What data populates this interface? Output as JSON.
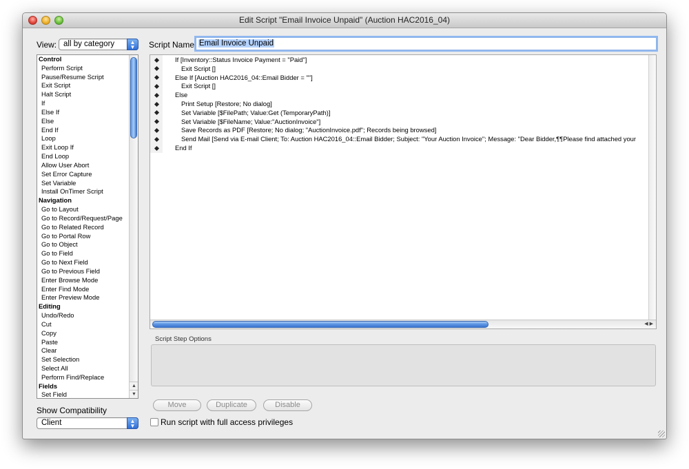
{
  "window": {
    "title": "Edit Script \"Email Invoice Unpaid\" (Auction HAC2016_04)"
  },
  "view": {
    "label": "View:",
    "value": "all by category"
  },
  "script_name": {
    "label": "Script Name:",
    "value": "Email Invoice Unpaid"
  },
  "steps": [
    {
      "label": "Control",
      "category": true
    },
    {
      "label": "Perform Script"
    },
    {
      "label": "Pause/Resume Script"
    },
    {
      "label": "Exit Script"
    },
    {
      "label": "Halt Script"
    },
    {
      "label": "If"
    },
    {
      "label": "Else If"
    },
    {
      "label": "Else"
    },
    {
      "label": "End If"
    },
    {
      "label": "Loop"
    },
    {
      "label": "Exit Loop If"
    },
    {
      "label": "End Loop"
    },
    {
      "label": "Allow User Abort"
    },
    {
      "label": "Set Error Capture"
    },
    {
      "label": "Set Variable"
    },
    {
      "label": "Install OnTimer Script"
    },
    {
      "label": "Navigation",
      "category": true
    },
    {
      "label": "Go to Layout"
    },
    {
      "label": "Go to Record/Request/Page"
    },
    {
      "label": "Go to Related Record"
    },
    {
      "label": "Go to Portal Row"
    },
    {
      "label": "Go to Object"
    },
    {
      "label": "Go to Field"
    },
    {
      "label": "Go to Next Field"
    },
    {
      "label": "Go to Previous Field"
    },
    {
      "label": "Enter Browse Mode"
    },
    {
      "label": "Enter Find Mode"
    },
    {
      "label": "Enter Preview Mode"
    },
    {
      "label": "Editing",
      "category": true
    },
    {
      "label": "Undo/Redo"
    },
    {
      "label": "Cut"
    },
    {
      "label": "Copy"
    },
    {
      "label": "Paste"
    },
    {
      "label": "Clear"
    },
    {
      "label": "Set Selection"
    },
    {
      "label": "Select All"
    },
    {
      "label": "Perform Find/Replace"
    },
    {
      "label": "Fields",
      "category": true
    },
    {
      "label": "Set Field"
    }
  ],
  "script_lines": [
    {
      "text": "If [Inventory::Status Invoice Payment = \"Paid\"]",
      "indent": 0
    },
    {
      "text": "Exit Script []",
      "indent": 1
    },
    {
      "text": "Else If [Auction HAC2016_04::Email Bidder = \"\"]",
      "indent": 0
    },
    {
      "text": "Exit Script []",
      "indent": 1
    },
    {
      "text": "Else",
      "indent": 0
    },
    {
      "text": "Print Setup [Restore; No dialog]",
      "indent": 1
    },
    {
      "text": "Set Variable [$FilePath; Value:Get (TemporaryPath)]",
      "indent": 1
    },
    {
      "text": "Set Variable [$FileName; Value:\"AuctionInvoice\"]",
      "indent": 1
    },
    {
      "text": "Save Records as PDF [Restore; No dialog; \"AuctionInvoice.pdf\"; Records being browsed]",
      "indent": 1
    },
    {
      "text": "Send Mail [Send via E-mail Client; To: Auction HAC2016_04::Email Bidder; Subject: \"Your Auction Invoice\"; Message: \"Dear Bidder,¶¶Please find attached your",
      "indent": 1
    },
    {
      "text": "End If",
      "indent": 0
    }
  ],
  "options": {
    "label": "Script Step Options"
  },
  "buttons": {
    "move": "Move",
    "duplicate": "Duplicate",
    "disable": "Disable"
  },
  "compat": {
    "label": "Show Compatibility",
    "value": "Client"
  },
  "full_access": {
    "label": "Run script with full access privileges",
    "checked": false
  }
}
